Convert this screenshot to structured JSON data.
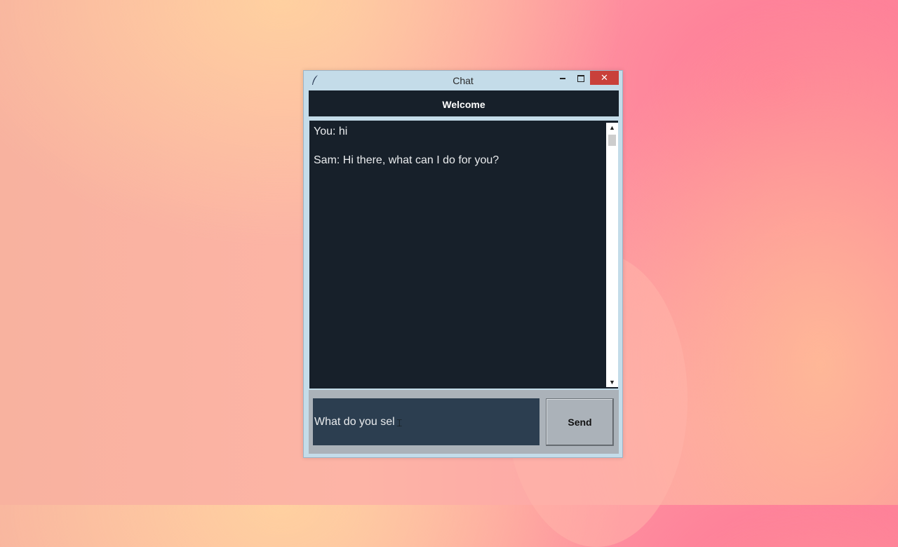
{
  "window": {
    "title": "Chat",
    "app_icon": "feather-icon",
    "controls": {
      "minimize": "minimize-icon",
      "maximize": "maximize-icon",
      "close": "✕"
    }
  },
  "header": {
    "title": "Welcome"
  },
  "messages": [
    {
      "text": "You: hi"
    },
    {
      "text": "Sam: Hi there, what can I do for you?"
    }
  ],
  "input": {
    "value": "What do you sel"
  },
  "send_button": {
    "label": "Send"
  },
  "colors": {
    "bg_dark": "#17202a",
    "input_bg": "#2c3e50",
    "panel_gray": "#abb2b9",
    "text_light": "#eaecee",
    "close_red": "#c9403a"
  }
}
